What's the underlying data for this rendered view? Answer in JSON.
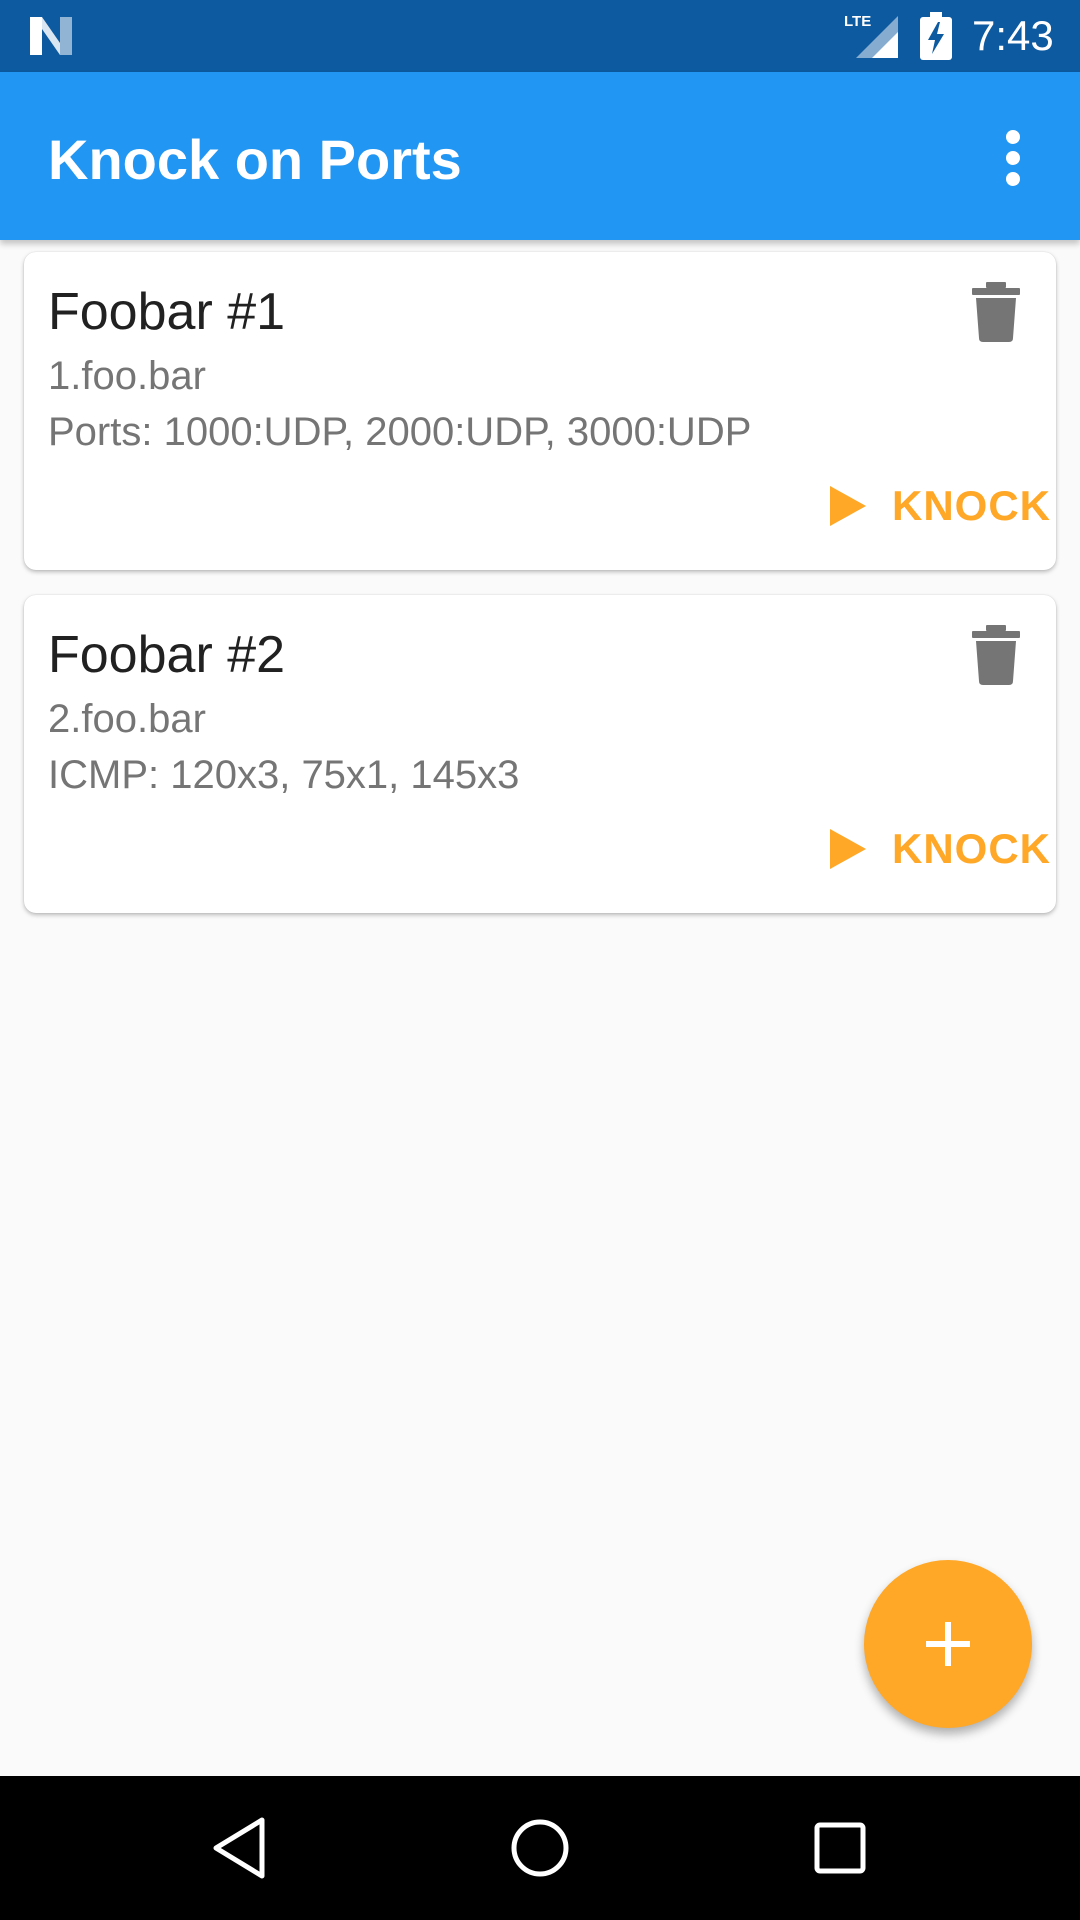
{
  "status_bar": {
    "time": "7:43",
    "network_label": "LTE",
    "icons": [
      "n-logo-icon",
      "lte-signal-icon",
      "battery-charging-icon"
    ]
  },
  "app_bar": {
    "title": "Knock on Ports",
    "overflow_icon": "more-vert-icon"
  },
  "cards": [
    {
      "name": "Foobar #1",
      "host": "1.foo.bar",
      "ports": "Ports: 1000:UDP, 2000:UDP, 3000:UDP",
      "action_label": "KNOCK"
    },
    {
      "name": "Foobar #2",
      "host": "2.foo.bar",
      "ports": "ICMP: 120x3, 75x1, 145x3",
      "action_label": "KNOCK"
    }
  ],
  "fab": {
    "icon": "plus-icon"
  },
  "nav_bar": {
    "icons": [
      "back-icon",
      "home-icon",
      "recents-icon"
    ]
  },
  "colors": {
    "status_bar": "#0D5AA0",
    "app_bar": "#2196F3",
    "accent": "#FFA726",
    "background": "#FAFAFA"
  }
}
